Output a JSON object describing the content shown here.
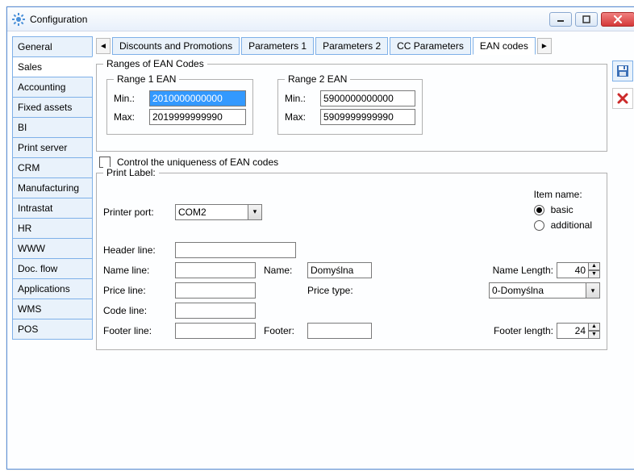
{
  "window": {
    "title": "Configuration"
  },
  "sidebar": {
    "items": [
      {
        "label": "General"
      },
      {
        "label": "Sales"
      },
      {
        "label": "Accounting"
      },
      {
        "label": "Fixed assets"
      },
      {
        "label": "BI"
      },
      {
        "label": "Print server"
      },
      {
        "label": "CRM"
      },
      {
        "label": "Manufacturing"
      },
      {
        "label": "Intrastat"
      },
      {
        "label": "HR"
      },
      {
        "label": "WWW"
      },
      {
        "label": "Doc. flow"
      },
      {
        "label": "Applications"
      },
      {
        "label": "WMS"
      },
      {
        "label": "POS"
      }
    ],
    "active_index": 1
  },
  "tabs": {
    "items": [
      {
        "label": "Discounts and Promotions"
      },
      {
        "label": "Parameters 1"
      },
      {
        "label": "Parameters 2"
      },
      {
        "label": "CC Parameters"
      },
      {
        "label": "EAN codes"
      }
    ],
    "active_index": 4
  },
  "ean": {
    "group_title": "Ranges of EAN Codes",
    "range1": {
      "title": "Range 1 EAN",
      "min_label": "Min.:",
      "min": "2010000000000",
      "max_label": "Max:",
      "max": "2019999999990"
    },
    "range2": {
      "title": "Range 2 EAN",
      "min_label": "Min.:",
      "min": "5900000000000",
      "max_label": "Max:",
      "max": "5909999999990"
    },
    "uniqueness_label": "Control the uniqueness of EAN codes",
    "uniqueness_checked": false
  },
  "print": {
    "group_title": "Print Label:",
    "printer_port_label": "Printer port:",
    "printer_port": "COM2",
    "header_label": "Header line:",
    "header": "",
    "name_line_label": "Name line:",
    "name_line": "",
    "name_label": "Name:",
    "name": "Domyślna",
    "name_length_label": "Name Length:",
    "name_length": "40",
    "price_line_label": "Price line:",
    "price_line": "",
    "price_type_label": "Price type:",
    "price_type": "0-Domyślna",
    "code_line_label": "Code line:",
    "code_line": "",
    "footer_line_label": "Footer line:",
    "footer_line": "",
    "footer_label": "Footer:",
    "footer": "",
    "footer_length_label": "Footer length:",
    "footer_length": "24"
  },
  "item_name": {
    "title": "Item name:",
    "basic": "basic",
    "additional": "additional",
    "selected": "basic"
  }
}
